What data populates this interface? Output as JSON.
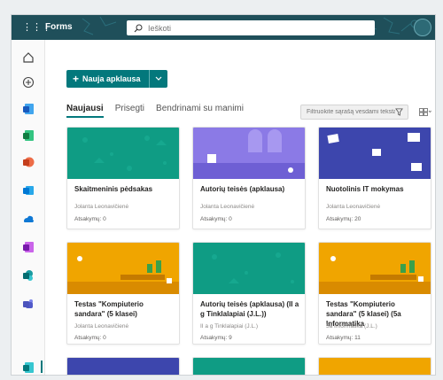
{
  "app": {
    "name": "Forms"
  },
  "search": {
    "placeholder": "Ieškoti"
  },
  "toolbar": {
    "new_label": "Nauja apklausa"
  },
  "tabs": [
    {
      "label": "Naujausi",
      "active": true
    },
    {
      "label": "Prisegti",
      "active": false
    },
    {
      "label": "Bendrinami su manimi",
      "active": false
    }
  ],
  "filter": {
    "placeholder": "Filtruokite sąrašą vesdami tekstą"
  },
  "rail_icons": [
    "home-icon",
    "add-icon",
    "word-icon",
    "excel-icon",
    "powerpoint-icon",
    "outlook-icon",
    "onedrive-icon",
    "onenote-icon",
    "sharepoint-icon",
    "teams-icon",
    "forms-icon"
  ],
  "cards": [
    {
      "title": "Skaitmeninis pėdsakas",
      "author": "Jolanta Leonavičienė",
      "responses": "Atsakymų: 0",
      "theme": "teal"
    },
    {
      "title": "Autorių teisės (apklausa)",
      "author": "Jolanta Leonavičienė",
      "responses": "Atsakymų: 0",
      "theme": "purple"
    },
    {
      "title": "Nuotolinis IT mokymas",
      "author": "Jolanta Leonavičienė",
      "responses": "Atsakymų: 20",
      "theme": "navy"
    },
    {
      "title": "Testas \"Kompiuterio sandara\" (5 klasei)",
      "author": "Jolanta Leonavičienė",
      "responses": "Atsakymų: 0",
      "theme": "orange"
    },
    {
      "title": "Autorių teisės (apklausa) (II a g Tinklalapiai (J.L.))",
      "author": "II a g Tinklalapiai (J.L.)",
      "responses": "Atsakymų: 9",
      "theme": "teal"
    },
    {
      "title": "Testas \"Kompiuterio sandara\" (5 klasei) (5a Informatika",
      "author": "5a Informatika (J.L.)",
      "responses": "Atsakymų: 11",
      "theme": "orange"
    }
  ],
  "colors": {
    "accent": "#03787c",
    "teal_card": "#0f9c84",
    "purple_card": "#8b7ae6",
    "navy_card": "#3d46ad",
    "orange_card": "#f0a500",
    "topbar": "#1f4f5a"
  }
}
